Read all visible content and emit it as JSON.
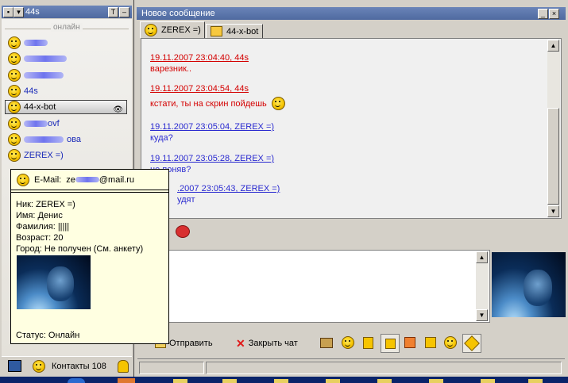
{
  "contacts_window": {
    "title": "44s",
    "group_label": "онлайн",
    "contacts": [
      {
        "label": "",
        "blurred": true,
        "blur_width": 30
      },
      {
        "label": "",
        "blurred": true,
        "blur_width": 54
      },
      {
        "label": "",
        "blurred": true,
        "blur_width": 50
      },
      {
        "label": "44s",
        "blurred": false
      },
      {
        "label": "44-x-bot",
        "blurred": false
      },
      {
        "label": "ovf",
        "blurred": true,
        "blur_width": 30
      },
      {
        "label": "ова",
        "blurred": true,
        "blur_width": 50
      },
      {
        "label": "ZEREX =)",
        "blurred": false
      }
    ],
    "footer_label": "Контакты 108"
  },
  "tooltip": {
    "email_label": "E-Mail:",
    "email_prefix": "ze",
    "email_suffix": "@mail.ru",
    "nick": "Ник: ZEREX =)",
    "name": "Имя: Денис",
    "surname": "Фамилия: |||||",
    "age": "Возраст: 20",
    "city": "Город: Не получен (См. анкету)",
    "status": "Статус: Онлайн"
  },
  "chat_window": {
    "title": "Новое сообщение",
    "tabs": [
      {
        "label": "ZEREX =)",
        "active": true
      },
      {
        "label": "44-x-bot",
        "active": false
      }
    ],
    "messages": [
      {
        "meta": "19.11.2007 23:04:40, 44s",
        "text": "варезник..",
        "from_me": true
      },
      {
        "meta": "19.11.2007 23:04:54, 44s",
        "text": "кстати, ты на скрин пойдешь",
        "from_me": true
      },
      {
        "meta": "19.11.2007 23:05:04, ZEREX =)",
        "text": "куда?",
        "from_me": false
      },
      {
        "meta": "19.11.2007 23:05:28, ZEREX =)",
        "text": "не поняв?",
        "from_me": false
      },
      {
        "meta": ".2007 23:05:43, ZEREX =)",
        "text": "удят",
        "from_me": false
      }
    ],
    "send_label": "Отправить",
    "close_label": "Закрыть чат"
  },
  "colors": {
    "my_message": "#d40000",
    "their_message": "#2a2ad0",
    "taskbar": "#0a246a"
  }
}
